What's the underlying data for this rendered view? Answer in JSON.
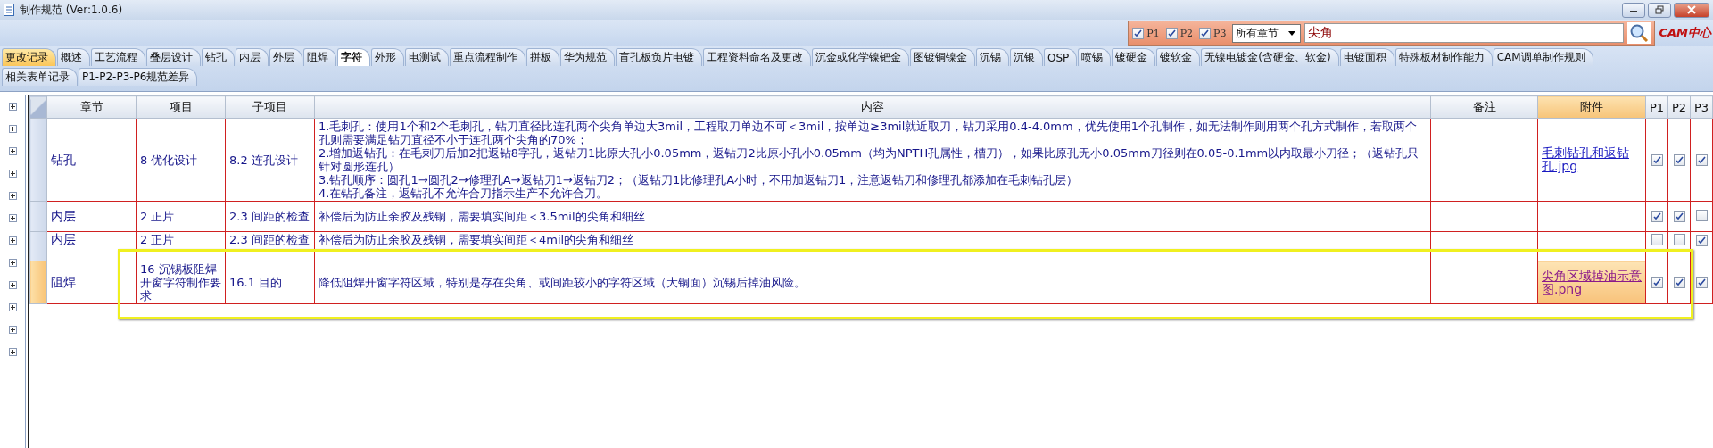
{
  "window": {
    "title": "制作规范 (Ver:1.0.6)"
  },
  "filter": {
    "checks": [
      {
        "label": "P1",
        "checked": true
      },
      {
        "label": "P2",
        "checked": true
      },
      {
        "label": "P3",
        "checked": true
      }
    ],
    "chapter": "所有章节",
    "search_value": "尖角",
    "logo": "CAM中心"
  },
  "tab_rows": [
    [
      {
        "label": "更改记录",
        "selected": false,
        "highlighted": true
      },
      {
        "label": "概述",
        "selected": false,
        "highlighted": false
      },
      {
        "label": "工艺流程",
        "selected": false,
        "highlighted": false
      },
      {
        "label": "叠层设计",
        "selected": false,
        "highlighted": false
      },
      {
        "label": "钻孔",
        "selected": false,
        "highlighted": false
      },
      {
        "label": "内层",
        "selected": false,
        "highlighted": false
      },
      {
        "label": "外层",
        "selected": false,
        "highlighted": false
      },
      {
        "label": "阻焊",
        "selected": false,
        "highlighted": false
      },
      {
        "label": "字符",
        "selected": true,
        "highlighted": false
      },
      {
        "label": "外形",
        "selected": false,
        "highlighted": false
      },
      {
        "label": "电测试",
        "selected": false,
        "highlighted": false
      },
      {
        "label": "重点流程制作",
        "selected": false,
        "highlighted": false
      },
      {
        "label": "拼板",
        "selected": false,
        "highlighted": false
      },
      {
        "label": "华为规范",
        "selected": false,
        "highlighted": false
      },
      {
        "label": "盲孔板负片电镀",
        "selected": false,
        "highlighted": false
      },
      {
        "label": "工程资料命名及更改",
        "selected": false,
        "highlighted": false
      },
      {
        "label": "沉金或化学镍钯金",
        "selected": false,
        "highlighted": false
      },
      {
        "label": "图镀铜镍金",
        "selected": false,
        "highlighted": false
      },
      {
        "label": "沉锡",
        "selected": false,
        "highlighted": false
      },
      {
        "label": "沉银",
        "selected": false,
        "highlighted": false
      },
      {
        "label": "OSP",
        "selected": false,
        "highlighted": false
      },
      {
        "label": "喷锡",
        "selected": false,
        "highlighted": false
      },
      {
        "label": "镀硬金",
        "selected": false,
        "highlighted": false
      },
      {
        "label": "镀软金",
        "selected": false,
        "highlighted": false
      },
      {
        "label": "无镍电镀金(含硬金、软金)",
        "selected": false,
        "highlighted": false
      },
      {
        "label": "电镀面积",
        "selected": false,
        "highlighted": false
      },
      {
        "label": "特殊板材制作能力",
        "selected": false,
        "highlighted": false
      },
      {
        "label": "CAM调单制作规则",
        "selected": false,
        "highlighted": false
      }
    ],
    [
      {
        "label": "相关表单记录",
        "selected": false,
        "highlighted": false
      },
      {
        "label": "P1-P2-P3-P6规范差异",
        "selected": false,
        "highlighted": false
      }
    ]
  ],
  "table": {
    "columns": [
      "章节",
      "项目",
      "子项目",
      "内容",
      "备注",
      "附件",
      "P1",
      "P2",
      "P3"
    ],
    "rows": [
      {
        "selected": false,
        "chapter": "钻孔",
        "item": "8 优化设计",
        "sub_item": "8.2 连孔设计",
        "content": [
          "1.毛刺孔：使用1个和2个毛刺孔，钻刀直径比连孔两个尖角单边大3mil，工程取刀单边不可＜3mil，按单边≥3mil就近取刀，钻刀采用0.4-4.0mm，优先使用1个孔制作，如无法制作则用两个孔方式制作，若取两个孔则需要满足钻刀直径不小于连孔两个尖角的70%；",
          "2.增加返钻孔：在毛刺刀后加2把返钻8字孔，返钻刀1比原大孔小0.05mm，返钻刀2比原小孔小0.05mm（均为NPTH孔属性，槽刀），如果比原孔无小0.05mm刀径则在0.05-0.1mm以内取最小刀径；（返钻孔只针对圆形连孔）",
          "3.钻孔顺序：圆孔1→圆孔2→修理孔A→返钻刀1→返钻刀2；（返钻刀1比修理孔A小时，不用加返钻刀1，注意返钻刀和修理孔都添加在毛刺钻孔层）",
          "4.在钻孔备注，返钻孔不允许合刀指示生产不允许合刀。"
        ],
        "attachment": {
          "name": "毛刺钻孔和返钻孔.jpg",
          "visited": false
        },
        "p1": true,
        "p2": true,
        "p3": true
      },
      {
        "selected": false,
        "chapter": "内层",
        "item": "2 正片",
        "sub_item": "2.3 间距的检查",
        "content": [
          "补偿后为防止余胶及残铜，需要填实间距＜3.5mil的尖角和细丝"
        ],
        "p1": true,
        "p2": true,
        "p3": false
      },
      {
        "selected": false,
        "chapter": "内层",
        "item": "2 正片",
        "sub_item": "2.3 间距的检查",
        "content": [
          "补偿后为防止余胶及残铜，需要填实间距＜4mil的尖角和细丝"
        ],
        "p1": false,
        "p2": false,
        "p3": true
      },
      {
        "selected": true,
        "chapter": "阻焊",
        "item": "16 沉锡板阻焊开窗字符制作要求",
        "sub_item": "16.1 目的",
        "content": [
          "降低阻焊开窗字符区域，特别是存在尖角、或间距较小的字符区域（大铜面）沉锡后掉油风险。"
        ],
        "attachment": {
          "name": "尖角区域掉油示意图.png",
          "visited": true
        },
        "p1": true,
        "p2": true,
        "p3": true
      }
    ]
  }
}
